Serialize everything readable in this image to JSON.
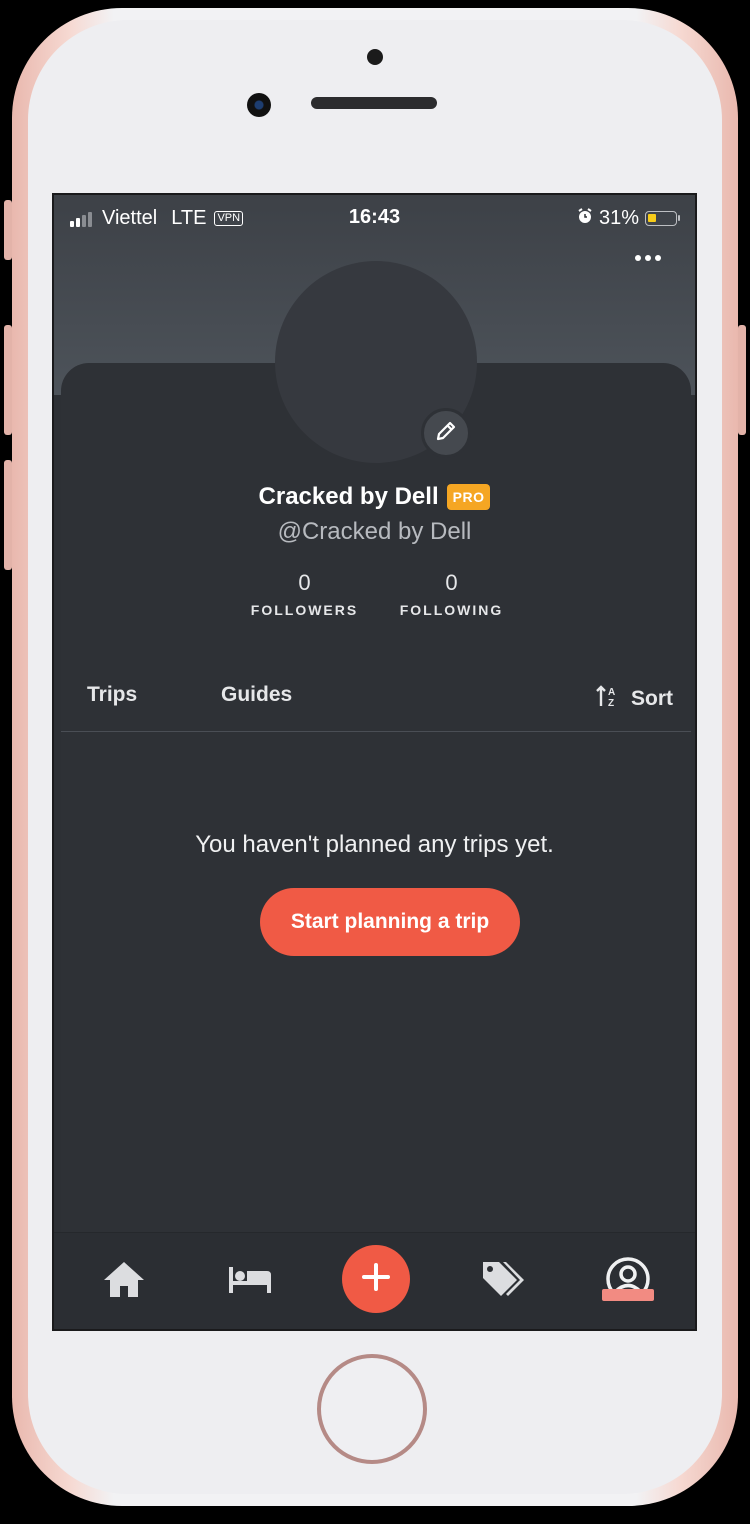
{
  "status_bar": {
    "carrier": "Viettel",
    "network": "LTE",
    "vpn": "VPN",
    "time": "16:43",
    "battery": "31%",
    "battery_level": 0.31
  },
  "profile": {
    "name": "Cracked by Dell",
    "badge": "PRO",
    "handle": "@Cracked by Dell",
    "followers_count": "0",
    "followers_label": "FOLLOWERS",
    "following_count": "0",
    "following_label": "FOLLOWING"
  },
  "tabs": {
    "trips": "Trips",
    "guides": "Guides",
    "sort": "Sort"
  },
  "empty_state": {
    "message": "You haven't planned any trips yet.",
    "cta": "Start planning a trip"
  },
  "bottom_nav": {
    "items": [
      "home-icon",
      "bed-icon",
      "plus-icon",
      "tags-icon",
      "profile-icon"
    ],
    "active": "profile-icon"
  },
  "colors": {
    "accent": "#f05a45",
    "pro_badge": "#f5a623",
    "background": "#2e3136"
  }
}
